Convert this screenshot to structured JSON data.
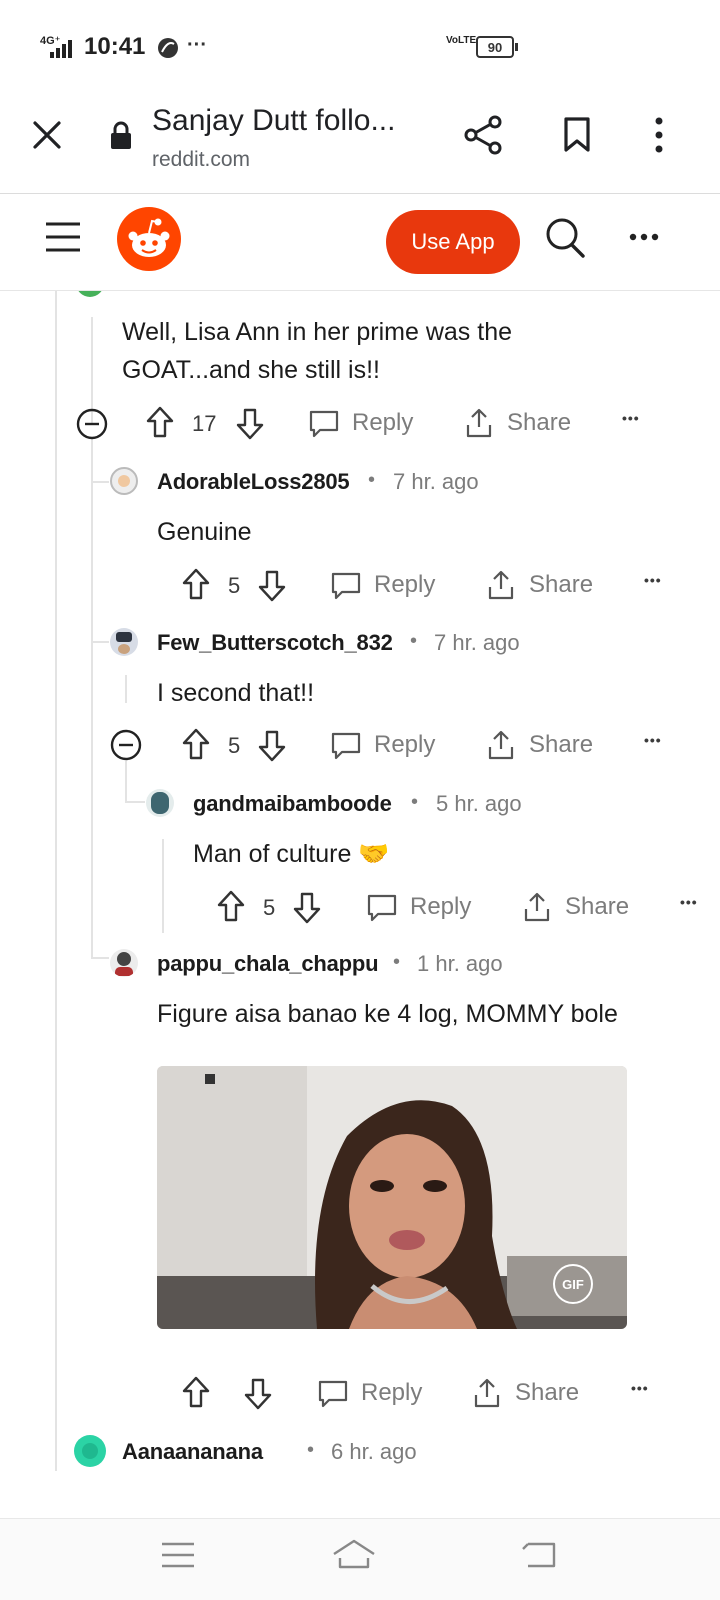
{
  "status_bar": {
    "network": "4G⁺",
    "time": "10:41",
    "dots": "···",
    "volte": "VoLTE",
    "battery": "90"
  },
  "browser": {
    "title": "Sanjay Dutt follo...",
    "url": "reddit.com"
  },
  "reddit_header": {
    "use_app": "Use App",
    "brand_color": "#e8380d"
  },
  "partial_comment": {
    "body_line1": "Well, Lisa Ann in her prime was the",
    "body_line2": "GOAT...and she still is!!",
    "votes": "17"
  },
  "comments": [
    {
      "username": "AdorableLoss2805",
      "time": "7 hr. ago",
      "body": "Genuine",
      "votes": "5"
    },
    {
      "username": "Few_Butterscotch_832",
      "time": "7 hr. ago",
      "body": "I second that!!",
      "votes": "5"
    },
    {
      "username": "gandmaibamboode",
      "time": "5 hr. ago",
      "body": "Man of culture 🤝",
      "votes": "5"
    },
    {
      "username": "pappu_chala_chappu",
      "time": "1 hr. ago",
      "body": "Figure aisa banao ke 4 log, MOMMY bole",
      "votes": ""
    },
    {
      "username": "Aanaananana",
      "time": "6 hr. ago"
    }
  ],
  "actions": {
    "reply": "Reply",
    "share": "Share",
    "more": "•••"
  },
  "gif": {
    "badge": "GIF"
  },
  "icons": {
    "close": "close-icon",
    "lock": "lock-icon",
    "share": "share-icon",
    "bookmark": "bookmark-icon",
    "menu": "kebab-icon",
    "hamburger": "hamburger-icon",
    "search": "search-icon",
    "upvote": "upvote-icon",
    "downvote": "downvote-icon"
  }
}
